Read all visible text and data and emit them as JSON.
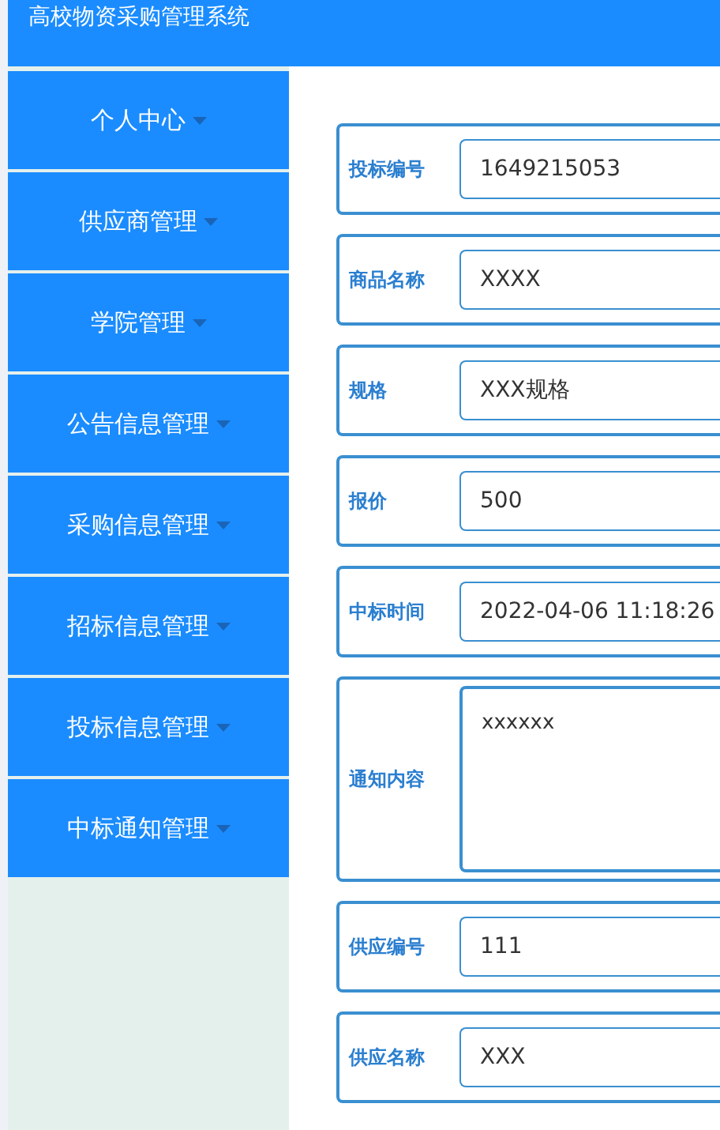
{
  "header": {
    "title": "高校物资采购管理系统"
  },
  "sidebar": {
    "items": [
      {
        "label": "个人中心"
      },
      {
        "label": "供应商管理"
      },
      {
        "label": "学院管理"
      },
      {
        "label": "公告信息管理"
      },
      {
        "label": "采购信息管理"
      },
      {
        "label": "招标信息管理"
      },
      {
        "label": "投标信息管理"
      },
      {
        "label": "中标通知管理"
      }
    ]
  },
  "form": {
    "fields": [
      {
        "kind": "input",
        "label": "投标编号",
        "value": "1649215053"
      },
      {
        "kind": "input",
        "label": "商品名称",
        "value": "XXXX"
      },
      {
        "kind": "input",
        "label": "规格",
        "value": "XXX规格"
      },
      {
        "kind": "input",
        "label": "报价",
        "value": "500"
      },
      {
        "kind": "input",
        "label": "中标时间",
        "value": "2022-04-06 11:18:26"
      },
      {
        "kind": "textarea",
        "label": "通知内容",
        "value": "xxxxxx"
      },
      {
        "kind": "input",
        "label": "供应编号",
        "value": "111"
      },
      {
        "kind": "input",
        "label": "供应名称",
        "value": "XXX"
      }
    ]
  }
}
